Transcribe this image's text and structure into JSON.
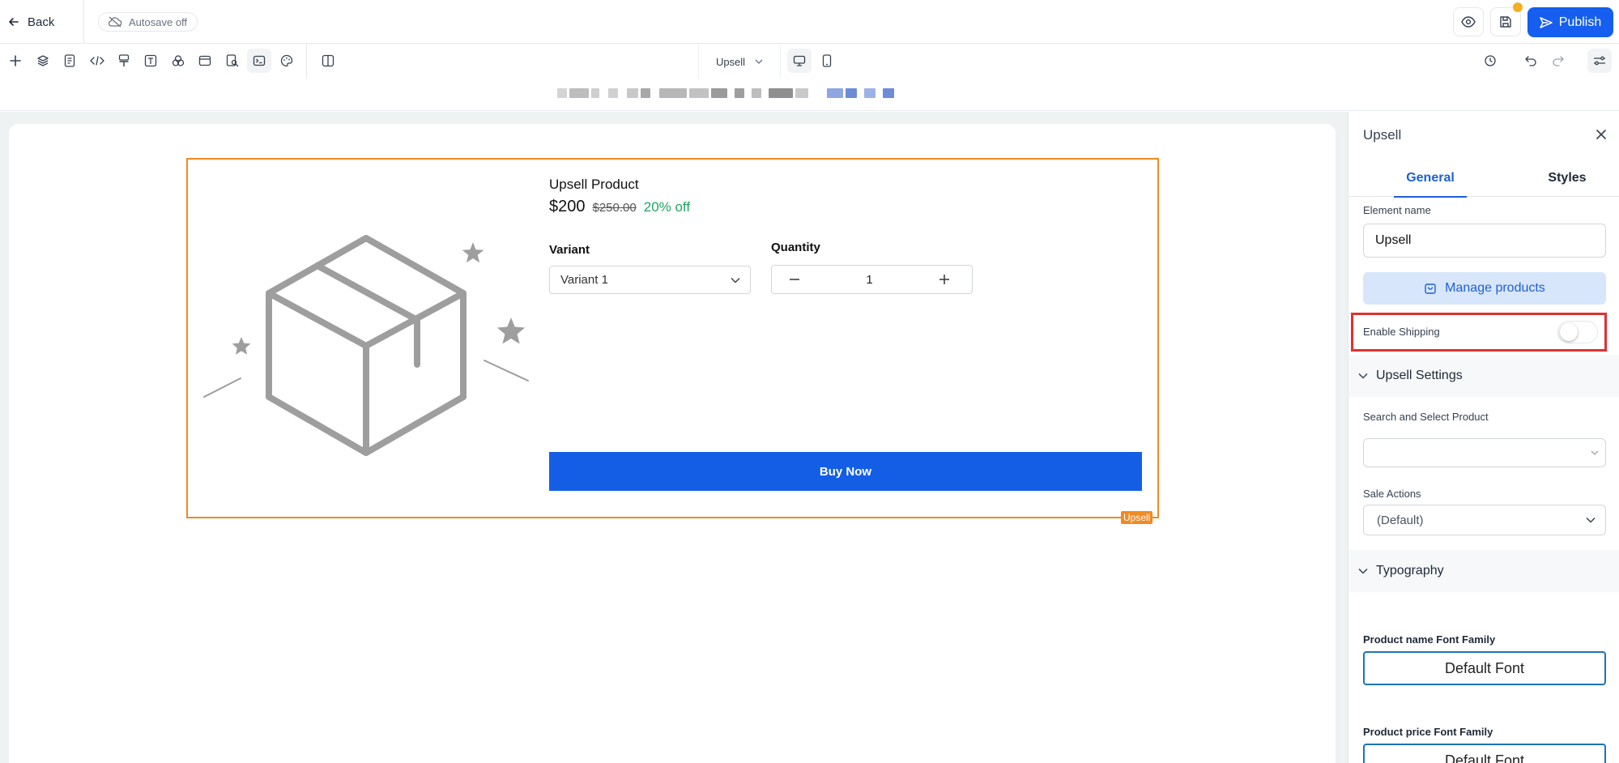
{
  "header": {
    "back_label": "Back",
    "autosave_label": "Autosave off",
    "publish_label": "Publish"
  },
  "toolbar": {
    "page_selector": "Upsell"
  },
  "upsell": {
    "product_name": "Upsell Product",
    "price": "$200",
    "old_price": "$250.00",
    "discount": "20% off",
    "variant_label": "Variant",
    "variant_value": "Variant 1",
    "quantity_label": "Quantity",
    "quantity_value": "1",
    "buy_label": "Buy Now",
    "tag": "Upsell"
  },
  "panel": {
    "title": "Upsell",
    "tabs": [
      "General",
      "Styles"
    ],
    "element_name_label": "Element name",
    "element_name_value": "Upsell",
    "manage_products_label": "Manage products",
    "enable_shipping_label": "Enable Shipping",
    "enable_shipping_on": false,
    "upsell_settings_label": "Upsell Settings",
    "search_product_label": "Search and Select Product",
    "search_product_value": "",
    "sale_actions_label": "Sale Actions",
    "sale_actions_value": "(Default)",
    "typography_label": "Typography",
    "product_name_font_label": "Product name Font Family",
    "product_name_font_value": "Default Font",
    "product_price_font_label": "Product price Font Family",
    "product_price_font_value": "Default Font"
  },
  "colors": {
    "primary": "#155eef",
    "selection": "#f08a24",
    "discount": "#22a463",
    "highlight": "#e03131"
  }
}
